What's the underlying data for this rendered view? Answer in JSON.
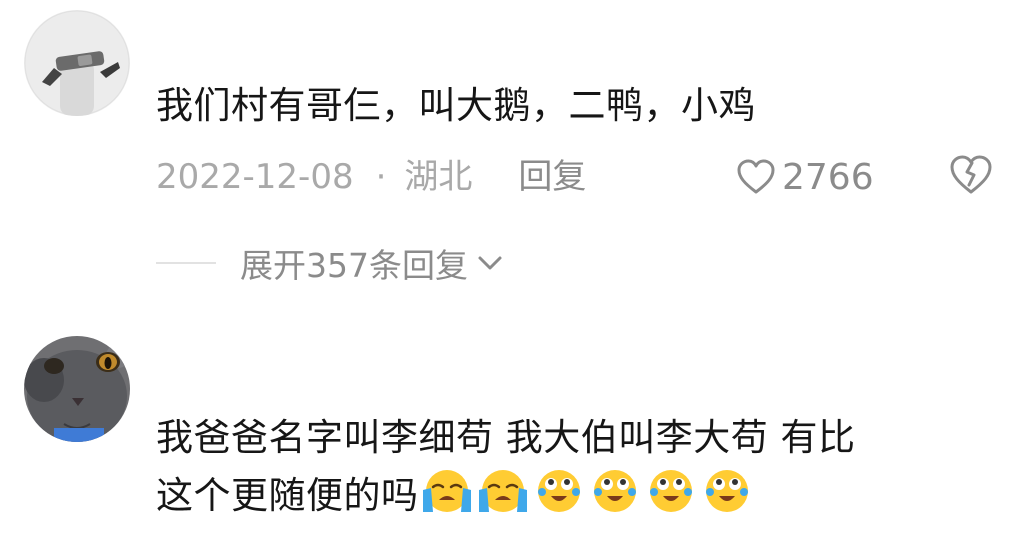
{
  "comments": [
    {
      "text": "我们村有哥仨，叫大鹅，二鸭，小鸡",
      "date": "2022-12-08",
      "separator": "·",
      "location": "湖北",
      "reply_label": "回复",
      "likes": "2766",
      "expand_replies": "展开357条回复"
    },
    {
      "text_line1": "我爸爸名字叫李细苟 我大伯叫李大苟 有比",
      "text_line2": "这个更随便的吗",
      "emojis": [
        "loudly-crying-emoji",
        "loudly-crying-emoji",
        "crying-laughing-emoji",
        "crying-laughing-emoji",
        "crying-laughing-emoji",
        "crying-laughing-emoji"
      ]
    }
  ],
  "colors": {
    "text": "#161616",
    "meta": "#a9a9a9",
    "action": "#8b8b8b",
    "divider": "#e2e2e2",
    "emoji_yellow": "#ffcc33",
    "tear_blue": "#3fa8ea"
  },
  "icons": {
    "like": "heart-outline-icon",
    "dislike": "broken-heart-icon",
    "expand": "chevron-down-icon"
  }
}
